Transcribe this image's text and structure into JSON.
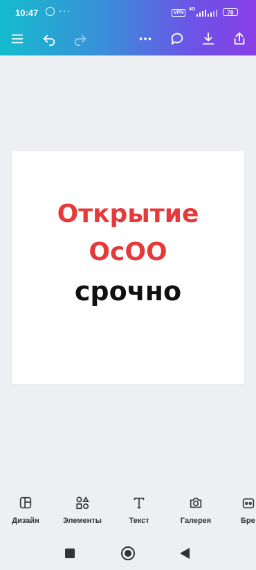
{
  "status_bar": {
    "time": "10:47",
    "overflow": "···",
    "vpn": "VPN",
    "network": "4G",
    "battery": "78"
  },
  "toolbar": {
    "icons": [
      "menu-icon",
      "undo-icon",
      "redo-icon",
      "more-icon",
      "comment-icon",
      "download-icon",
      "share-icon"
    ]
  },
  "canvas": {
    "line1": "Открытие",
    "line2": "ОсОО",
    "line3": "срочно",
    "accent_color": "#e63a3a",
    "text_color": "#111111"
  },
  "bottom_toolbar": {
    "items": [
      {
        "label": "Дизайн",
        "icon": "design-icon"
      },
      {
        "label": "Элементы",
        "icon": "elements-icon"
      },
      {
        "label": "Текст",
        "icon": "text-icon"
      },
      {
        "label": "Галерея",
        "icon": "camera-icon"
      },
      {
        "label": "Бре",
        "icon": "brand-icon"
      }
    ]
  },
  "colors": {
    "toolbar_gradient_start": "#14bccd",
    "toolbar_gradient_end": "#8a3fe6",
    "background": "#eeeff3"
  }
}
